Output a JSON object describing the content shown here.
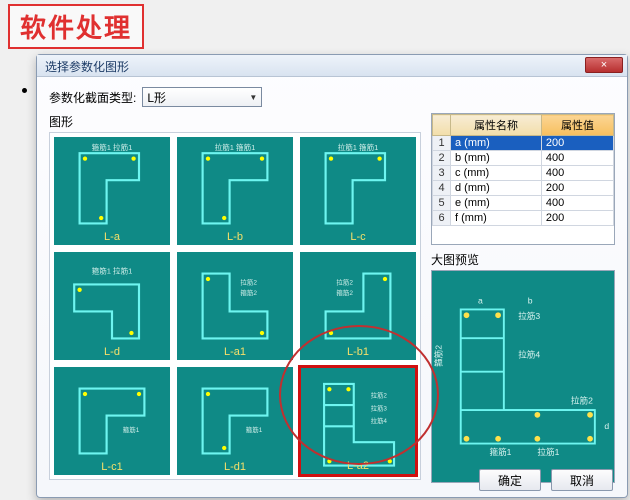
{
  "stamp": "软件处理",
  "dialog": {
    "title": "选择参数化图形",
    "close": "×",
    "section_type_label": "参数化截面类型:",
    "section_type_value": "L形",
    "grid_label": "图形",
    "preview_label": "大图预览",
    "ok": "确定",
    "cancel": "取消"
  },
  "thumbs": [
    {
      "label": "L-a"
    },
    {
      "label": "L-b"
    },
    {
      "label": "L-c"
    },
    {
      "label": "L-d"
    },
    {
      "label": "L-a1"
    },
    {
      "label": "L-b1"
    },
    {
      "label": "L-c1"
    },
    {
      "label": "L-d1"
    },
    {
      "label": "L-a2"
    }
  ],
  "selected_thumb": 8,
  "property_table": {
    "col_name": "属性名称",
    "col_value": "属性值",
    "rows": [
      {
        "n": "1",
        "name": "a (mm)",
        "value": "200"
      },
      {
        "n": "2",
        "name": "b (mm)",
        "value": "400"
      },
      {
        "n": "3",
        "name": "c (mm)",
        "value": "400"
      },
      {
        "n": "4",
        "name": "d (mm)",
        "value": "200"
      },
      {
        "n": "5",
        "name": "e (mm)",
        "value": "400"
      },
      {
        "n": "6",
        "name": "f (mm)",
        "value": "200"
      }
    ],
    "selected_row": 0
  },
  "preview_labels": {
    "l1": "箍筋2",
    "l2": "拉筋3",
    "l3": "拉筋4",
    "l4": "箍筋1",
    "l5": "拉筋1",
    "l6": "拉筋2"
  }
}
